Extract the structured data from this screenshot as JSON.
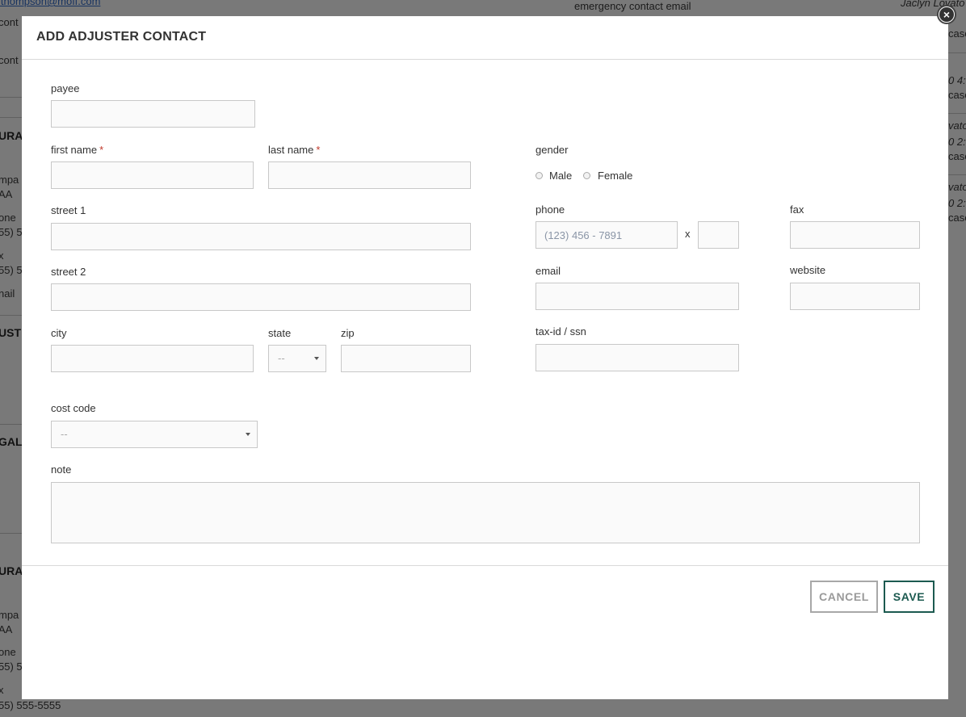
{
  "background": {
    "texts": [
      {
        "t": "ithompson@moff.com",
        "cls": "bg-link"
      },
      {
        "t": "cont",
        "cls": ""
      },
      {
        "t": "cont",
        "cls": ""
      },
      {
        "t": "emergency contact email",
        "cls": ""
      },
      {
        "t": "Jaclyn Lovato",
        "cls": "bg-italic"
      },
      {
        "t": "URA",
        "cls": "bg-bold"
      },
      {
        "t": "mpa",
        "cls": ""
      },
      {
        "t": "AA",
        "cls": ""
      },
      {
        "t": "one",
        "cls": ""
      },
      {
        "t": "55) 5",
        "cls": ""
      },
      {
        "t": "x",
        "cls": ""
      },
      {
        "t": "55) 5",
        "cls": ""
      },
      {
        "t": "nail",
        "cls": ""
      },
      {
        "t": "UST",
        "cls": "bg-bold"
      },
      {
        "t": "GAL",
        "cls": "bg-bold"
      },
      {
        "t": "URA",
        "cls": "bg-bold"
      },
      {
        "t": "mpa",
        "cls": ""
      },
      {
        "t": "AA",
        "cls": ""
      },
      {
        "t": "one",
        "cls": ""
      },
      {
        "t": "55) 5",
        "cls": ""
      },
      {
        "t": "x",
        "cls": ""
      },
      {
        "t": "55) 555-5555",
        "cls": ""
      },
      {
        "t": "case",
        "cls": ""
      },
      {
        "t": "case",
        "cls": ""
      },
      {
        "t": "case",
        "cls": ""
      },
      {
        "t": "case",
        "cls": ""
      },
      {
        "t": "vato",
        "cls": "bg-italic"
      },
      {
        "t": "vato",
        "cls": "bg-italic"
      },
      {
        "t": "0 4:",
        "cls": "bg-italic"
      },
      {
        "t": "0 2:",
        "cls": "bg-italic"
      },
      {
        "t": "0 2:",
        "cls": "bg-italic"
      }
    ]
  },
  "modal": {
    "title": "ADD ADJUSTER CONTACT",
    "close_icon": "×",
    "fields": {
      "payee": {
        "label": "payee",
        "value": ""
      },
      "first_name": {
        "label": "first name",
        "required": "*",
        "value": ""
      },
      "last_name": {
        "label": "last name",
        "required": "*",
        "value": ""
      },
      "gender": {
        "label": "gender",
        "options": [
          "Male",
          "Female"
        ]
      },
      "street1": {
        "label": "street 1",
        "value": ""
      },
      "street2": {
        "label": "street 2",
        "value": ""
      },
      "phone": {
        "label": "phone",
        "placeholder": "(123) 456 - 7891",
        "ext_sep": "x"
      },
      "fax": {
        "label": "fax",
        "value": ""
      },
      "email": {
        "label": "email",
        "value": ""
      },
      "website": {
        "label": "website",
        "value": ""
      },
      "city": {
        "label": "city",
        "value": ""
      },
      "state": {
        "label": "state",
        "value": "--"
      },
      "zip": {
        "label": "zip",
        "value": ""
      },
      "tax_id": {
        "label": "tax-id / ssn",
        "value": ""
      },
      "cost_code": {
        "label": "cost code",
        "value": "--"
      },
      "note": {
        "label": "note",
        "value": ""
      }
    },
    "buttons": {
      "cancel": "CANCEL",
      "save": "SAVE"
    },
    "colors": {
      "accent": "#1c5a50",
      "required": "#c0392b"
    }
  }
}
